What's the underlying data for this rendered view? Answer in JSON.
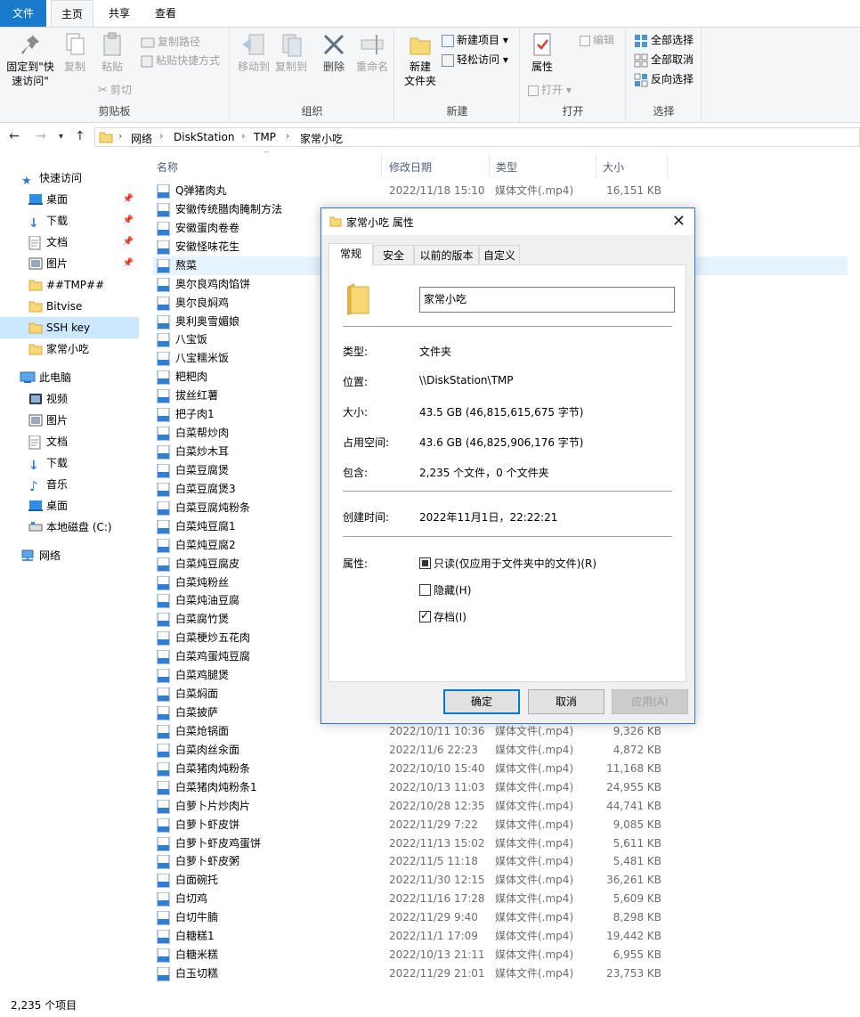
{
  "ribbon": {
    "tabs": [
      "文件",
      "主页",
      "共享",
      "查看"
    ],
    "clipboard": {
      "pin_label_1": "固定到\"快",
      "pin_label_2": "速访问\"",
      "copy": "复制",
      "paste": "粘贴",
      "copy_path": "复制路径",
      "paste_shortcut": "粘贴快捷方式",
      "cut": "剪切",
      "title": "剪贴板"
    },
    "organize": {
      "move_to": "移动到",
      "copy_to": "复制到",
      "delete": "删除",
      "rename": "重命名",
      "title": "组织"
    },
    "new": {
      "new_folder_1": "新建",
      "new_folder_2": "文件夹",
      "new_item": "新建项目",
      "easy_access": "轻松访问",
      "title": "新建"
    },
    "open": {
      "properties": "属性",
      "open": "打开",
      "edit": "编辑",
      "title": "打开"
    },
    "select": {
      "select_all": "全部选择",
      "select_none": "全部取消",
      "invert": "反向选择",
      "title": "选择"
    }
  },
  "address": {
    "crumbs": [
      "网络",
      "DiskStation",
      "TMP",
      "家常小吃"
    ]
  },
  "nav": {
    "quick_access": "快速访问",
    "quick_items": [
      "桌面",
      "下载",
      "文档",
      "图片",
      "##TMP##",
      "Bitvise",
      "SSH key",
      "家常小吃"
    ],
    "this_pc": "此电脑",
    "pc_items": [
      "视频",
      "图片",
      "文档",
      "下载",
      "音乐",
      "桌面",
      "本地磁盘 (C:)"
    ],
    "network": "网络"
  },
  "list": {
    "headers": [
      "名称",
      "修改日期",
      "类型",
      "大小"
    ],
    "rows": [
      {
        "name": "Q弹猪肉丸",
        "date": "2022/11/18 15:10",
        "type": "媒体文件(.mp4)",
        "size": "16,151 KB"
      },
      {
        "name": "安徽传统腊肉腌制方法",
        "date": "",
        "type": "",
        "size": ""
      },
      {
        "name": "安徽蛋肉卷卷",
        "date": "",
        "type": "",
        "size": ""
      },
      {
        "name": "安徽怪味花生",
        "date": "",
        "type": "",
        "size": ""
      },
      {
        "name": "熬菜",
        "date": "",
        "type": "",
        "size": ""
      },
      {
        "name": "奥尔良鸡肉馅饼",
        "date": "",
        "type": "",
        "size": ""
      },
      {
        "name": "奥尔良焖鸡",
        "date": "",
        "type": "",
        "size": ""
      },
      {
        "name": "奥利奥雪媚娘",
        "date": "",
        "type": "",
        "size": ""
      },
      {
        "name": "八宝饭",
        "date": "",
        "type": "",
        "size": ""
      },
      {
        "name": "八宝糯米饭",
        "date": "",
        "type": "",
        "size": ""
      },
      {
        "name": "粑粑肉",
        "date": "",
        "type": "",
        "size": ""
      },
      {
        "name": "拔丝红薯",
        "date": "",
        "type": "",
        "size": ""
      },
      {
        "name": "把子肉1",
        "date": "",
        "type": "",
        "size": ""
      },
      {
        "name": "白菜帮炒肉",
        "date": "",
        "type": "",
        "size": ""
      },
      {
        "name": "白菜炒木耳",
        "date": "",
        "type": "",
        "size": ""
      },
      {
        "name": "白菜豆腐煲",
        "date": "",
        "type": "",
        "size": ""
      },
      {
        "name": "白菜豆腐煲3",
        "date": "",
        "type": "",
        "size": ""
      },
      {
        "name": "白菜豆腐炖粉条",
        "date": "",
        "type": "",
        "size": ""
      },
      {
        "name": "白菜炖豆腐1",
        "date": "",
        "type": "",
        "size": ""
      },
      {
        "name": "白菜炖豆腐2",
        "date": "",
        "type": "",
        "size": ""
      },
      {
        "name": "白菜炖豆腐皮",
        "date": "",
        "type": "",
        "size": ""
      },
      {
        "name": "白菜炖粉丝",
        "date": "",
        "type": "",
        "size": ""
      },
      {
        "name": "白菜炖油豆腐",
        "date": "",
        "type": "",
        "size": ""
      },
      {
        "name": "白菜腐竹煲",
        "date": "",
        "type": "",
        "size": ""
      },
      {
        "name": "白菜梗炒五花肉",
        "date": "",
        "type": "",
        "size": ""
      },
      {
        "name": "白菜鸡蛋炖豆腐",
        "date": "",
        "type": "",
        "size": ""
      },
      {
        "name": "白菜鸡腿煲",
        "date": "",
        "type": "",
        "size": ""
      },
      {
        "name": "白菜焖面",
        "date": "",
        "type": "",
        "size": ""
      },
      {
        "name": "白菜披萨",
        "date": "",
        "type": "",
        "size": ""
      },
      {
        "name": "白菜炝锅面",
        "date": "2022/10/11 10:36",
        "type": "媒体文件(.mp4)",
        "size": "9,326 KB"
      },
      {
        "name": "白菜肉丝汆面",
        "date": "2022/11/6 22:23",
        "type": "媒体文件(.mp4)",
        "size": "4,872 KB"
      },
      {
        "name": "白菜猪肉炖粉条",
        "date": "2022/10/10 15:40",
        "type": "媒体文件(.mp4)",
        "size": "11,168 KB"
      },
      {
        "name": "白菜猪肉炖粉条1",
        "date": "2022/10/13 11:03",
        "type": "媒体文件(.mp4)",
        "size": "24,955 KB"
      },
      {
        "name": "白萝卜片炒肉片",
        "date": "2022/10/28 12:35",
        "type": "媒体文件(.mp4)",
        "size": "44,741 KB"
      },
      {
        "name": "白萝卜虾皮饼",
        "date": "2022/11/29 7:22",
        "type": "媒体文件(.mp4)",
        "size": "9,085 KB"
      },
      {
        "name": "白萝卜虾皮鸡蛋饼",
        "date": "2022/11/13 15:02",
        "type": "媒体文件(.mp4)",
        "size": "5,611 KB"
      },
      {
        "name": "白萝卜虾皮粥",
        "date": "2022/11/5 11:18",
        "type": "媒体文件(.mp4)",
        "size": "5,481 KB"
      },
      {
        "name": "白面碗托",
        "date": "2022/11/30 12:15",
        "type": "媒体文件(.mp4)",
        "size": "36,261 KB"
      },
      {
        "name": "白切鸡",
        "date": "2022/11/16 17:28",
        "type": "媒体文件(.mp4)",
        "size": "5,609 KB"
      },
      {
        "name": "白切牛腩",
        "date": "2022/11/29 9:40",
        "type": "媒体文件(.mp4)",
        "size": "8,298 KB"
      },
      {
        "name": "白糖糕1",
        "date": "2022/11/1 17:09",
        "type": "媒体文件(.mp4)",
        "size": "19,442 KB"
      },
      {
        "name": "白糖米糕",
        "date": "2022/10/13 21:11",
        "type": "媒体文件(.mp4)",
        "size": "6,955 KB"
      },
      {
        "name": "白玉切糕",
        "date": "2022/11/29 21:01",
        "type": "媒体文件(.mp4)",
        "size": "23,753 KB"
      }
    ]
  },
  "status": {
    "count": "2,235 个项目"
  },
  "dialog": {
    "title": "家常小吃 属性",
    "tabs": [
      "常规",
      "安全",
      "以前的版本",
      "自定义"
    ],
    "name": "家常小吃",
    "type_label": "类型:",
    "type_value": "文件夹",
    "location_label": "位置:",
    "location_value": "\\\\DiskStation\\TMP",
    "size_label": "大小:",
    "size_value": "43.5 GB (46,815,615,675 字节)",
    "disk_label": "占用空间:",
    "disk_value": "43.6 GB (46,825,906,176 字节)",
    "contains_label": "包含:",
    "contains_value": "2,235 个文件，0 个文件夹",
    "created_label": "创建时间:",
    "created_value": "2022年11月1日，22:22:21",
    "attr_label": "属性:",
    "readonly": "只读(仅应用于文件夹中的文件)(R)",
    "hidden": "隐藏(H)",
    "archive": "存档(I)",
    "ok": "确定",
    "cancel": "取消",
    "apply": "应用(A)"
  },
  "colors": {
    "accent": "#1979ca",
    "selected": "#cce8ff",
    "folder": "#f8d775"
  }
}
